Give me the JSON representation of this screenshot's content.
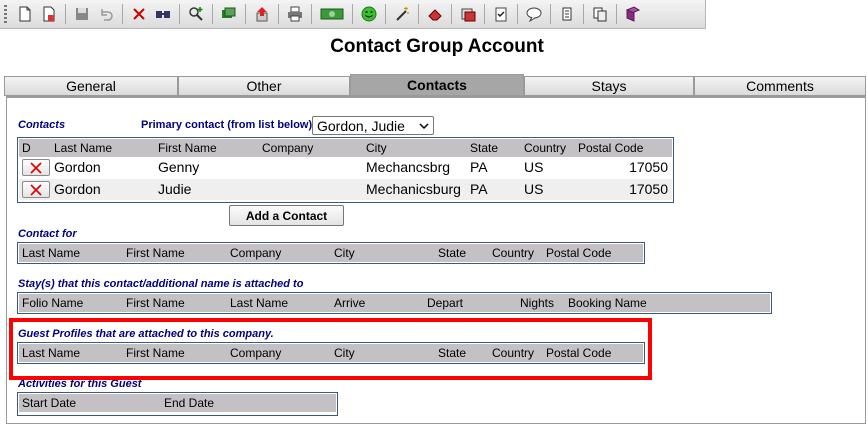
{
  "toolbar": {
    "icons": [
      "new-document-icon",
      "copy-document-icon",
      "save-icon",
      "undo-icon",
      "delete-icon",
      "binoculars-icon",
      "find-add-icon",
      "cards-icon",
      "export-icon",
      "print-icon",
      "money-icon",
      "smiley-icon",
      "wand-icon",
      "eraser-icon",
      "stack-icon",
      "checklist-icon",
      "speech-bubble-icon",
      "scroll-icon",
      "copy-pages-icon",
      "book-icon"
    ]
  },
  "page": {
    "title": "Contact Group Account"
  },
  "tabs": [
    {
      "label": "General"
    },
    {
      "label": "Other"
    },
    {
      "label": "Contacts"
    },
    {
      "label": "Stays"
    },
    {
      "label": "Comments"
    }
  ],
  "contacts": {
    "section_label": "Contacts",
    "primary_label": "Primary contact (from list below)",
    "primary_value": "Gordon, Judie",
    "columns": [
      "D",
      "Last Name",
      "First Name",
      "Company",
      "City",
      "State",
      "Country",
      "Postal Code"
    ],
    "rows": [
      {
        "last": "Gordon",
        "first": "Genny",
        "company": "",
        "city": "Mechancsbrg",
        "state": "PA",
        "country": "US",
        "postal": "17050"
      },
      {
        "last": "Gordon",
        "first": "Judie",
        "company": "",
        "city": "Mechanicsburg",
        "state": "PA",
        "country": "US",
        "postal": "17050"
      }
    ],
    "add_button": "Add a Contact"
  },
  "contact_for": {
    "section_label": "Contact for",
    "columns": [
      "Last Name",
      "First Name",
      "Company",
      "City",
      "State",
      "Country",
      "Postal Code"
    ]
  },
  "stays": {
    "section_label": "Stay(s) that this contact/additional name is attached to",
    "columns": [
      "Folio Name",
      "First Name",
      "Last Name",
      "Arrive",
      "Depart",
      "Nights",
      "Booking Name"
    ]
  },
  "guest_profiles": {
    "section_label": "Guest Profiles that are attached to this company.",
    "columns": [
      "Last Name",
      "First Name",
      "Company",
      "City",
      "State",
      "Country",
      "Postal Code"
    ]
  },
  "activities": {
    "section_label": "Activities for this Guest",
    "columns": [
      "Start Date",
      "End Date"
    ]
  },
  "colors": {
    "section_label": "#000080",
    "header_bg": "#c4c1c4",
    "highlight": "#ff0000",
    "active_tab": "#a6a6a6"
  }
}
